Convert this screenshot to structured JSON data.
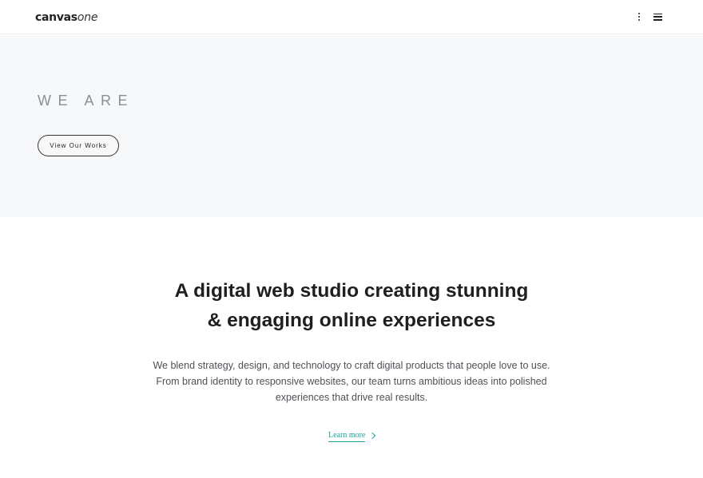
{
  "header": {
    "logo_bold": "canvas",
    "logo_italic": "one",
    "icons": [
      "more-vertical-icon",
      "menu-icon"
    ]
  },
  "hero": {
    "title": "WE ARE",
    "button_label": "View Our Works"
  },
  "about": {
    "heading_lines": [
      "A digital web studio creating stunning",
      "& engaging online experiences"
    ],
    "body_lines": [
      "We blend strategy, design, and technology to craft digital products that people love to use.",
      "From brand identity to responsive websites, our team turns ambitious ideas into polished",
      "experiences that drive real results."
    ],
    "link_label": "Learn more"
  },
  "colors": {
    "hero_bg": "#f7f8fa",
    "accent": "#1aa39a",
    "heading": "#1e1f21",
    "body_text": "#4d5156"
  }
}
